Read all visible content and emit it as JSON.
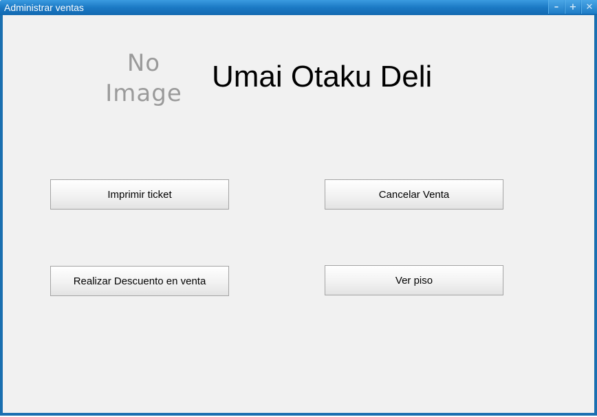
{
  "window": {
    "title": "Administrar ventas",
    "controls": {
      "minimize": "–",
      "maximize": "+",
      "close": "✕"
    }
  },
  "main": {
    "image_placeholder_line1": "No",
    "image_placeholder_line2": "Image",
    "store_name": "Umai Otaku Deli",
    "buttons": {
      "print": "Imprimir ticket",
      "cancel": "Cancelar Venta",
      "discount": "Realizar Descuento en venta",
      "floor": "Ver piso"
    }
  },
  "colors": {
    "titlebar": "#1b79c4",
    "window_border": "#1a6fb0",
    "background": "#f1f1f1"
  }
}
